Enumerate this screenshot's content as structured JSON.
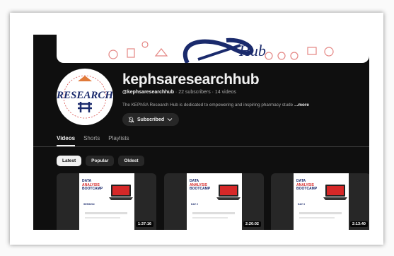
{
  "channel": {
    "name": "kephsaresearchhub",
    "handle": "@kephsaresearchhub",
    "stats": " · 22 subscribers · 14 videos",
    "description": "The KEPhSA Research Hub is dedicated to empowering and inspiring pharmacy stude",
    "more_label": "...more",
    "subscribe_label": "Subscribed",
    "avatar_text": "RESEARCH",
    "banner_text": "Hub"
  },
  "tabs": [
    {
      "label": "Videos"
    },
    {
      "label": "Shorts"
    },
    {
      "label": "Playlists"
    }
  ],
  "filters": [
    {
      "label": "Latest"
    },
    {
      "label": "Popular"
    },
    {
      "label": "Oldest"
    }
  ],
  "thumbnail_text": {
    "title_line1": "DATA",
    "title_line2": "ANALYSIS",
    "title_line3": "BOOTCAMP",
    "session_1": "SESSION",
    "session_2": "DAY 2",
    "session_3": "DAY 3"
  },
  "videos": [
    {
      "duration": "1:37:16"
    },
    {
      "duration": "2:20:02"
    },
    {
      "duration": "2:13:40"
    }
  ],
  "colors": {
    "background": "#0f0f0f",
    "chip": "#272727",
    "text_primary": "#f1f1f1",
    "text_secondary": "#aaaaaa",
    "accent_red": "#d62828",
    "banner_blue": "#1a2a6c"
  },
  "icons": {
    "bell": "bell-off-icon",
    "chevron": "chevron-down-icon"
  }
}
